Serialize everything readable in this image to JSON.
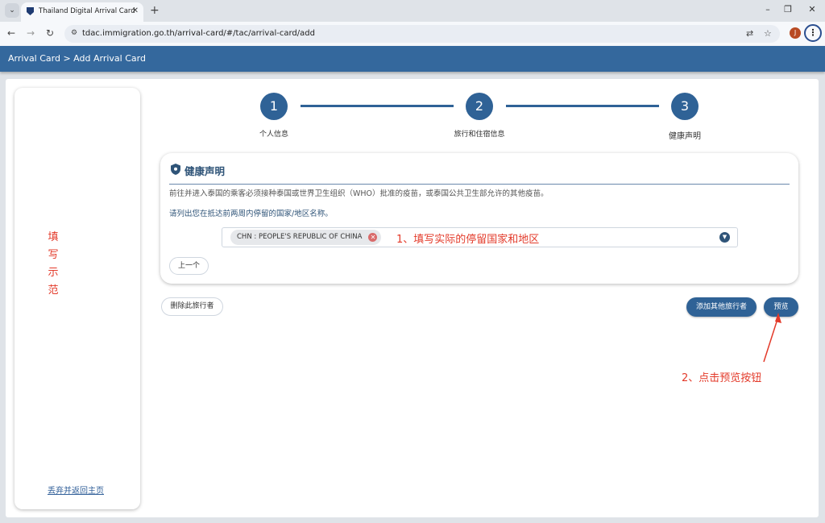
{
  "browser": {
    "tab_title": "Thailand Digital Arrival Card",
    "tab_close": "✕",
    "new_tab": "+",
    "url": "tdac.immigration.go.th/arrival-card/#/tac/arrival-card/add",
    "avatar_letter": "J"
  },
  "header": {
    "breadcrumb": "Arrival Card > Add Arrival Card"
  },
  "sidebar": {
    "sample_chars": [
      "填",
      "写",
      "示",
      "范"
    ],
    "discard_link": "丢弃并返回主页"
  },
  "stepper": {
    "steps": [
      {
        "number": "1",
        "label": "个人信息"
      },
      {
        "number": "2",
        "label": "旅行和住宿信息"
      },
      {
        "number": "3",
        "label": "健康声明"
      }
    ]
  },
  "health": {
    "title": "健康声明",
    "description": "前往并进入泰国的乘客必须接种泰国或世界卫生组织（WHO）批准的疫苗，或泰国公共卫生部允许的其他疫苗。",
    "ask": "请列出您在抵达前两周内停留的国家/地区名称。",
    "selected_country": "CHN : PEOPLE'S REPUBLIC OF CHINA",
    "prev_button": "上一个"
  },
  "actions": {
    "delete_traveler": "删除此旅行者",
    "add_traveler": "添加其他旅行者",
    "preview": "预览"
  },
  "annotations": {
    "step1": "1、填写实际的停留国家和地区",
    "step2": "2、点击预览按钮"
  },
  "colors": {
    "primary": "#2f6296",
    "header": "#34689d",
    "annotation": "#e33a2a"
  }
}
